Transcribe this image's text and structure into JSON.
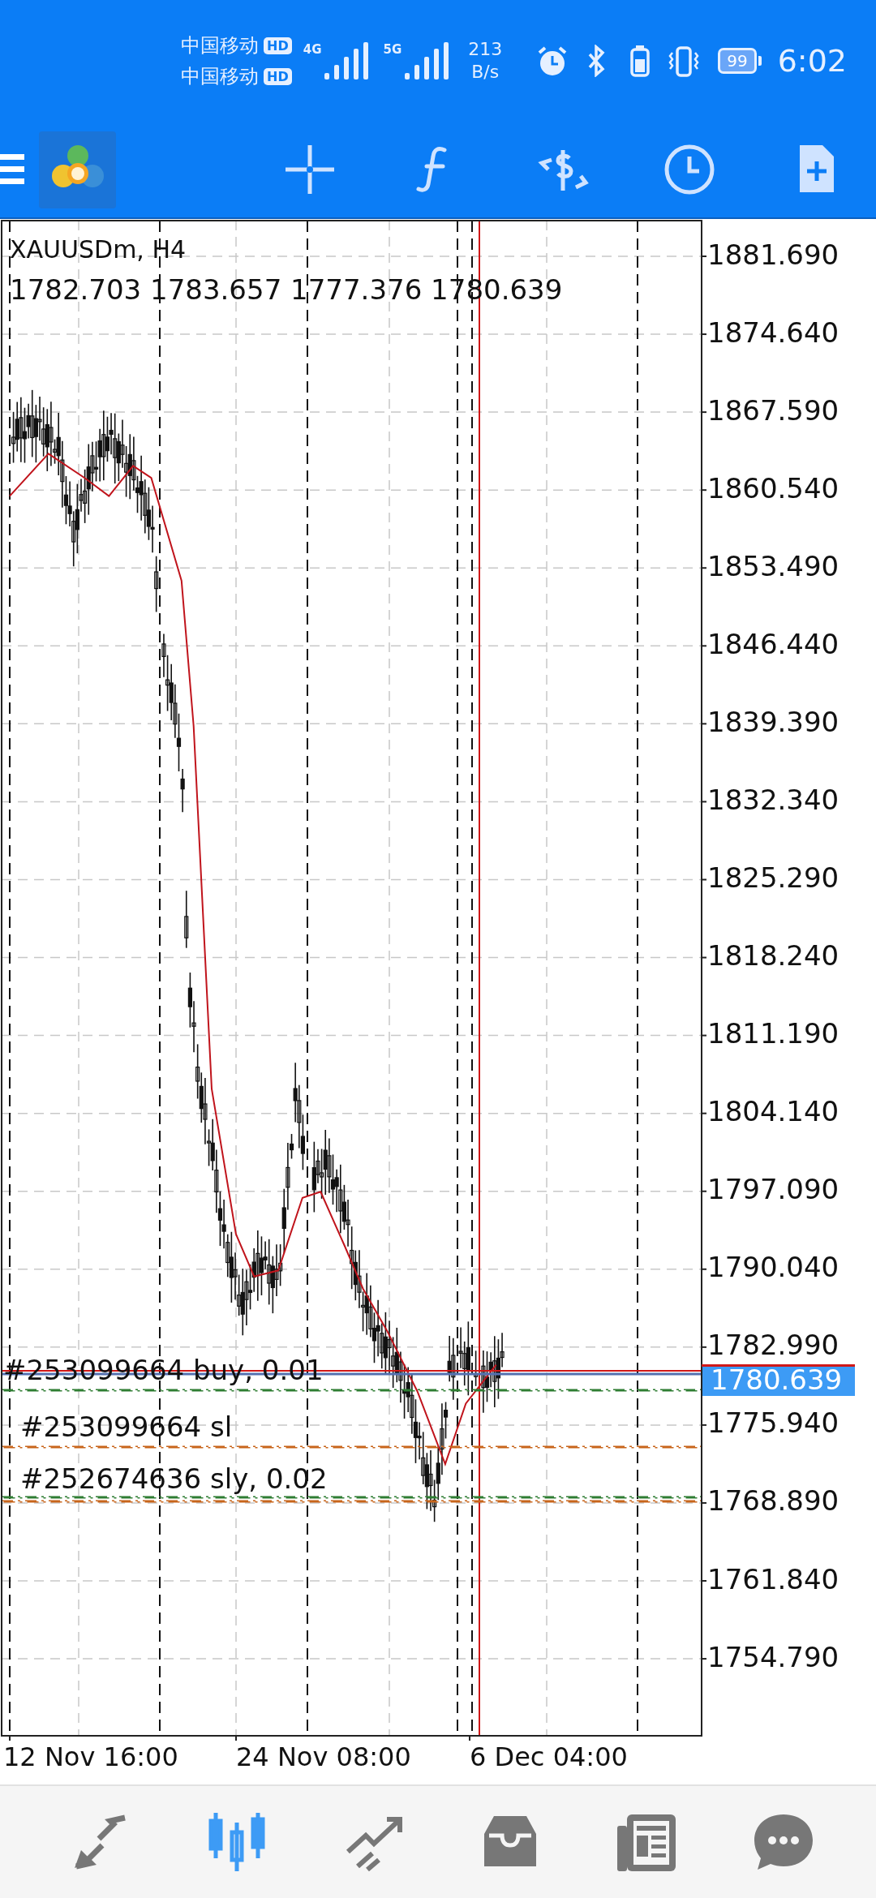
{
  "status_bar": {
    "carriers": [
      {
        "name": "中国移动",
        "badge": "HD"
      },
      {
        "name": "中国移动",
        "badge": "HD"
      }
    ],
    "networks": [
      "4G",
      "5G"
    ],
    "speed": "213",
    "speed_unit": "B/s",
    "battery": "99",
    "time": "6:02"
  },
  "chart": {
    "symbol": "XAUUSDm, H4",
    "ohlc": "1782.703 1783.657 1777.376 1780.639",
    "price_labels": [
      "1881.690",
      "1874.640",
      "1867.590",
      "1860.540",
      "1853.490",
      "1846.440",
      "1839.390",
      "1832.340",
      "1825.290",
      "1818.240",
      "1811.190",
      "1804.140",
      "1797.090",
      "1790.040",
      "1782.990",
      "1775.940",
      "1768.890",
      "1761.840",
      "1754.790"
    ],
    "current_price": "1780.639",
    "order_lines": [
      {
        "label": "#253099664 buy, 0.01",
        "color": "#5470b0",
        "kind": "solid"
      },
      {
        "color": "#2e7d32",
        "kind": "dashdot"
      },
      {
        "label": "#253099664 sl",
        "color": "#c8651b",
        "kind": "dashdot"
      },
      {
        "label": "#252674636 sly, 0.02",
        "color": "#2e7d32",
        "kind": "dashdot"
      },
      {
        "color": "#c8651b",
        "kind": "dashdot"
      }
    ],
    "time_labels": [
      "12 Nov 16:00",
      "24 Nov 08:00",
      "6 Dec 04:00"
    ]
  },
  "bottom_nav": [
    {
      "kind": "quotes",
      "selected": false
    },
    {
      "kind": "chart",
      "selected": true
    },
    {
      "kind": "trade",
      "selected": false
    },
    {
      "kind": "history",
      "selected": false
    },
    {
      "kind": "news",
      "selected": false
    },
    {
      "kind": "chat",
      "selected": false
    }
  ]
}
